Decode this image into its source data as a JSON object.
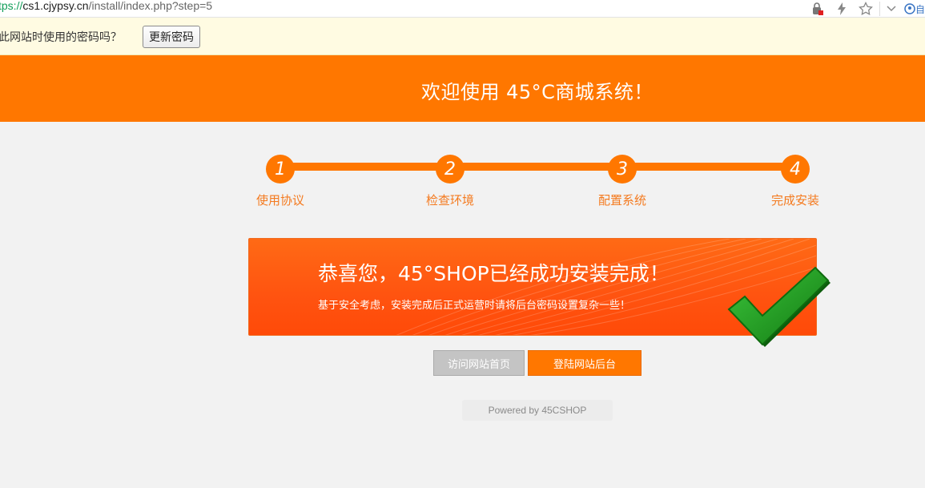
{
  "browser": {
    "url_scheme": "tps://",
    "url_host": "cs1.cjypsy.cn",
    "url_path": "/install/index.php?step=5",
    "user_label": "自"
  },
  "password_bar": {
    "question": "此网站时使用的密码吗？",
    "update_button": "更新密码"
  },
  "header": {
    "title": "欢迎使用 45°C商城系统！"
  },
  "steps": [
    {
      "number": "1",
      "label": "使用协议"
    },
    {
      "number": "2",
      "label": "检查环境"
    },
    {
      "number": "3",
      "label": "配置系统"
    },
    {
      "number": "4",
      "label": "完成安装"
    }
  ],
  "banner": {
    "headline": "恭喜您，45°SHOP已经成功安装完成！",
    "subtext": "基于安全考虑，安装完成后正式运营时请将后台密码设置复杂一些！"
  },
  "buttons": {
    "visit_home": "访问网站首页",
    "login_admin": "登陆网站后台"
  },
  "footer": {
    "powered_by": "Powered by 45CSHOP"
  },
  "colors": {
    "brand_orange": "#ff7700",
    "check_green": "#1f9d1f"
  }
}
